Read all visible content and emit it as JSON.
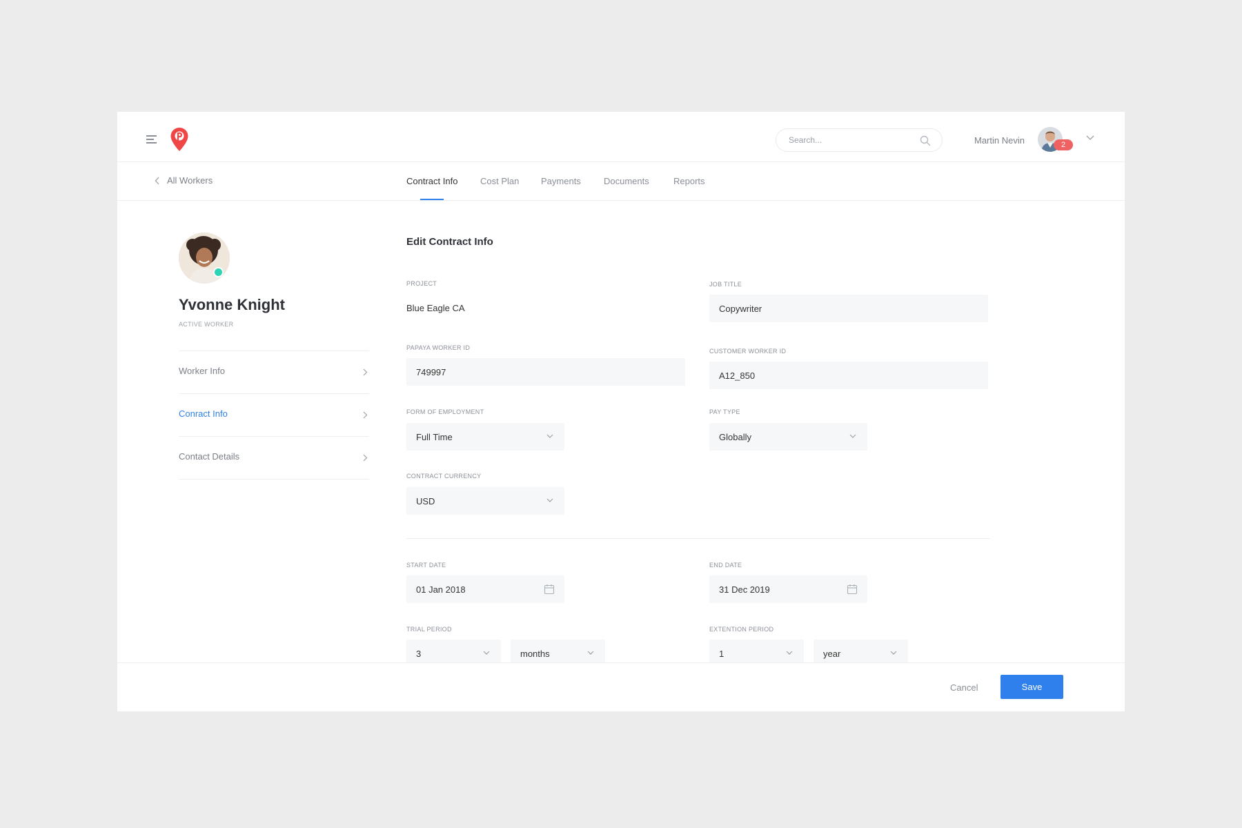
{
  "header": {
    "search_placeholder": "Search...",
    "user_name": "Martin Nevin",
    "notification_count": "2"
  },
  "subnav": {
    "back_label": "All Workers",
    "tabs": [
      {
        "label": "Contract Info",
        "active": true
      },
      {
        "label": "Cost Plan",
        "active": false
      },
      {
        "label": "Payments",
        "active": false
      },
      {
        "label": "Documents",
        "active": false
      },
      {
        "label": "Reports",
        "active": false
      }
    ]
  },
  "profile": {
    "name": "Yvonne Knight",
    "status": "ACTIVE WORKER",
    "status_color": "#2dd4b4"
  },
  "sidebar": {
    "items": [
      {
        "label": "Worker Info",
        "active": false
      },
      {
        "label": "Conract Info",
        "active": true
      },
      {
        "label": "Contact Details",
        "active": false
      }
    ]
  },
  "form": {
    "title": "Edit Contract Info",
    "project": {
      "label": "PROJECT",
      "value": "Blue Eagle CA"
    },
    "job_title": {
      "label": "JOB TITLE",
      "value": "Copywriter"
    },
    "papaya_worker_id": {
      "label": "PAPAYA WORKER ID",
      "value": "749997"
    },
    "customer_worker_id": {
      "label": "CUSTOMER WORKER ID",
      "value": "A12_850"
    },
    "form_of_employment": {
      "label": "FORM OF EMPLOYMENT",
      "value": "Full Time"
    },
    "pay_type": {
      "label": "PAY TYPE",
      "value": "Globally"
    },
    "contract_currency": {
      "label": "CONTRACT CURRENCY",
      "value": "USD"
    },
    "start_date": {
      "label": "START DATE",
      "value": "01 Jan 2018"
    },
    "end_date": {
      "label": "END DATE",
      "value": "31 Dec 2019"
    },
    "trial_period": {
      "label": "TRIAL PERIOD",
      "amount": "3",
      "unit": "months"
    },
    "extension_period": {
      "label": "EXTENTION PERIOD",
      "amount": "1",
      "unit": "year"
    }
  },
  "footer": {
    "cancel_label": "Cancel",
    "save_label": "Save"
  },
  "colors": {
    "accent": "#2f80ed",
    "brand": "#ef4646",
    "badge": "#f06262"
  }
}
